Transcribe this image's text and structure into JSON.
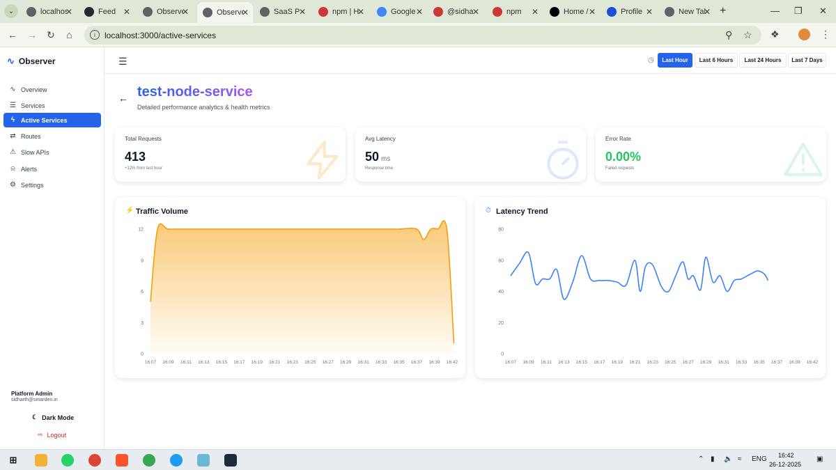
{
  "browser": {
    "tabs": [
      {
        "label": "localhost",
        "color": "#5f6368"
      },
      {
        "label": "Feed",
        "color": "#24292f"
      },
      {
        "label": "Observer",
        "color": "#5f6368"
      },
      {
        "label": "Observer",
        "color": "#5f6368"
      },
      {
        "label": "SaaS Platform",
        "color": "#5f6368"
      },
      {
        "label": "npm | Home",
        "color": "#cb3837"
      },
      {
        "label": "Google Cloud",
        "color": "#4285f4"
      },
      {
        "label": "@sidharth",
        "color": "#cb3837"
      },
      {
        "label": "npm",
        "color": "#cb3837"
      },
      {
        "label": "Home / X",
        "color": "#000000"
      },
      {
        "label": "Profile",
        "color": "#1d4ed8"
      },
      {
        "label": "New Tab",
        "color": "#5f6368"
      }
    ],
    "url": "localhost:3000/active-services"
  },
  "sidebar": {
    "brand": "Observer",
    "items": [
      {
        "label": "Overview",
        "icon": "activity-icon"
      },
      {
        "label": "Services",
        "icon": "server-icon"
      },
      {
        "label": "Active Services",
        "icon": "zap-icon"
      },
      {
        "label": "Routes",
        "icon": "route-icon"
      },
      {
        "label": "Slow APIs",
        "icon": "alert-triangle-icon"
      },
      {
        "label": "Alerts",
        "icon": "bell-icon"
      },
      {
        "label": "Settings",
        "icon": "gear-icon"
      }
    ],
    "user_name": "Platform Admin",
    "user_email": "sidharth@smarden.in",
    "dark_mode_label": "Dark Mode",
    "logout_label": "Logout"
  },
  "topbar": {
    "ranges": [
      "Last Hour",
      "Last 6 Hours",
      "Last 24 Hours",
      "Last 7 Days"
    ],
    "active_range": "Last Hour"
  },
  "page": {
    "title": "test-node-service",
    "subtitle": "Detailed performance analytics & health metrics"
  },
  "stats": {
    "total_requests": {
      "label": "Total Requests",
      "value": "413",
      "sub": "+12% from last hour"
    },
    "avg_latency": {
      "label": "Avg Latency",
      "value": "50",
      "unit": "ms",
      "sub": "Response time"
    },
    "error_rate": {
      "label": "Error Rate",
      "value": "0.00%",
      "sub": "Failed requests"
    }
  },
  "colors": {
    "accent": "#2563eb",
    "traffic": "#f59e0b",
    "latency": "#3b82f6",
    "success": "#22c55e"
  },
  "chart_data": [
    {
      "type": "area",
      "title": "Traffic Volume",
      "x_ticks": [
        "16:07",
        "16:09",
        "16:11",
        "16:13",
        "16:15",
        "16:17",
        "16:19",
        "16:21",
        "16:23",
        "16:25",
        "16:27",
        "16:29",
        "16:31",
        "16:33",
        "16:35",
        "16:37",
        "16:39",
        "16:42"
      ],
      "y_ticks": [
        0,
        3,
        6,
        9,
        12
      ],
      "ylim": [
        0,
        12
      ],
      "x": [
        0,
        0.4,
        1,
        2,
        3,
        4,
        5,
        6,
        7,
        8,
        9,
        10,
        11,
        12,
        13,
        14,
        15,
        15.4,
        15.8,
        16.2,
        16.7,
        17.1
      ],
      "values": [
        5,
        12,
        12,
        12,
        12,
        12,
        12,
        12,
        12,
        12,
        12,
        12,
        12,
        12,
        12,
        12,
        12,
        11,
        12,
        12,
        12,
        1
      ]
    },
    {
      "type": "line",
      "title": "Latency Trend",
      "x_ticks": [
        "16:07",
        "16:09",
        "16:11",
        "16:13",
        "16:15",
        "16:17",
        "16:19",
        "16:21",
        "16:23",
        "16:25",
        "16:27",
        "16:29",
        "16:31",
        "16:33",
        "16:35",
        "16:37",
        "16:39",
        "16:42"
      ],
      "y_ticks": [
        0,
        20,
        40,
        60,
        80
      ],
      "ylim": [
        0,
        80
      ],
      "x": [
        0,
        0.5,
        1,
        1.4,
        1.8,
        2.2,
        2.6,
        3.0,
        3.5,
        4.0,
        4.5,
        5.0,
        5.5,
        6.0,
        6.5,
        7.0,
        7.3,
        7.6,
        8.0,
        8.5,
        8.9,
        9.3,
        9.7,
        10.0,
        10.3,
        10.7,
        11.0,
        11.4,
        11.8,
        12.2,
        12.6,
        13.0,
        13.5,
        14.0,
        14.5,
        15.0,
        15.5,
        16.0,
        16.5,
        17.2
      ],
      "values": [
        50,
        58,
        65,
        45,
        48,
        48,
        54,
        35,
        46,
        63,
        48,
        47,
        47,
        46,
        44,
        60,
        40,
        56,
        57,
        43,
        40,
        50,
        59,
        48,
        50,
        41,
        62,
        46,
        50,
        40,
        47,
        48,
        51,
        53,
        47,
        23
      ]
    }
  ]
}
